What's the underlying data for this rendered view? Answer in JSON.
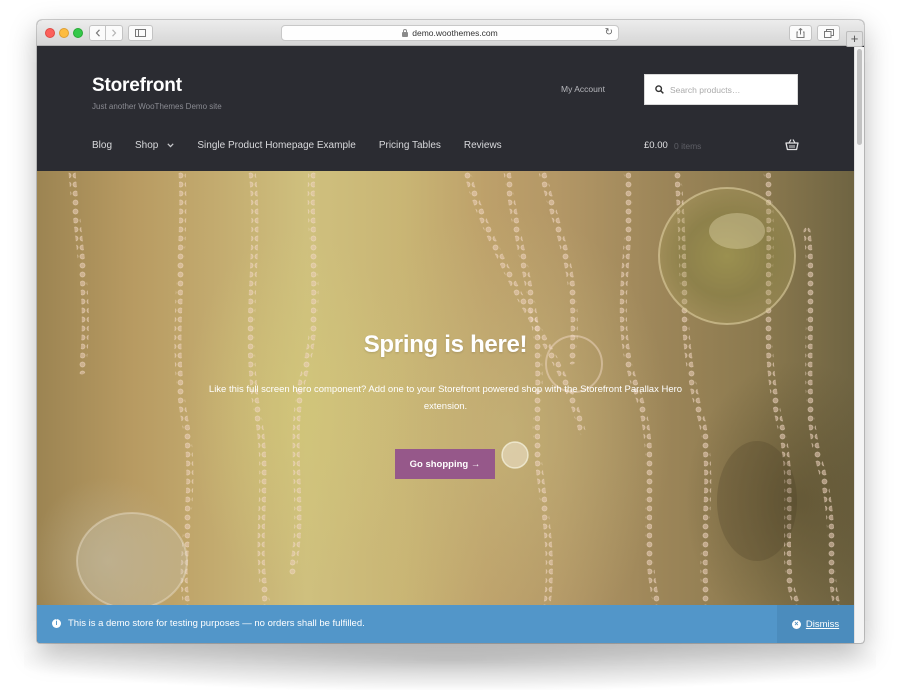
{
  "browser": {
    "url": "demo.woothemes.com"
  },
  "header": {
    "site_title": "Storefront",
    "tagline": "Just another WooThemes Demo site",
    "my_account": "My Account",
    "search_placeholder": "Search products…"
  },
  "nav": {
    "items": [
      {
        "label": "Blog"
      },
      {
        "label": "Shop"
      },
      {
        "label": "Single Product Homepage Example"
      },
      {
        "label": "Pricing Tables"
      },
      {
        "label": "Reviews"
      }
    ]
  },
  "cart": {
    "total": "£0.00",
    "count": "0 items"
  },
  "hero": {
    "title": "Spring is here!",
    "text": "Like this full screen hero component? Add one to your Storefront powered shop with the Storefront Parallax Hero extension.",
    "button_label": "Go shopping →"
  },
  "notice": {
    "text": "This is a demo store for testing purposes — no orders shall be fulfilled.",
    "dismiss_label": "Dismiss"
  },
  "colors": {
    "header_bg": "#2b2c32",
    "accent_button": "#96588a",
    "notice_bg": "#5296c9"
  }
}
